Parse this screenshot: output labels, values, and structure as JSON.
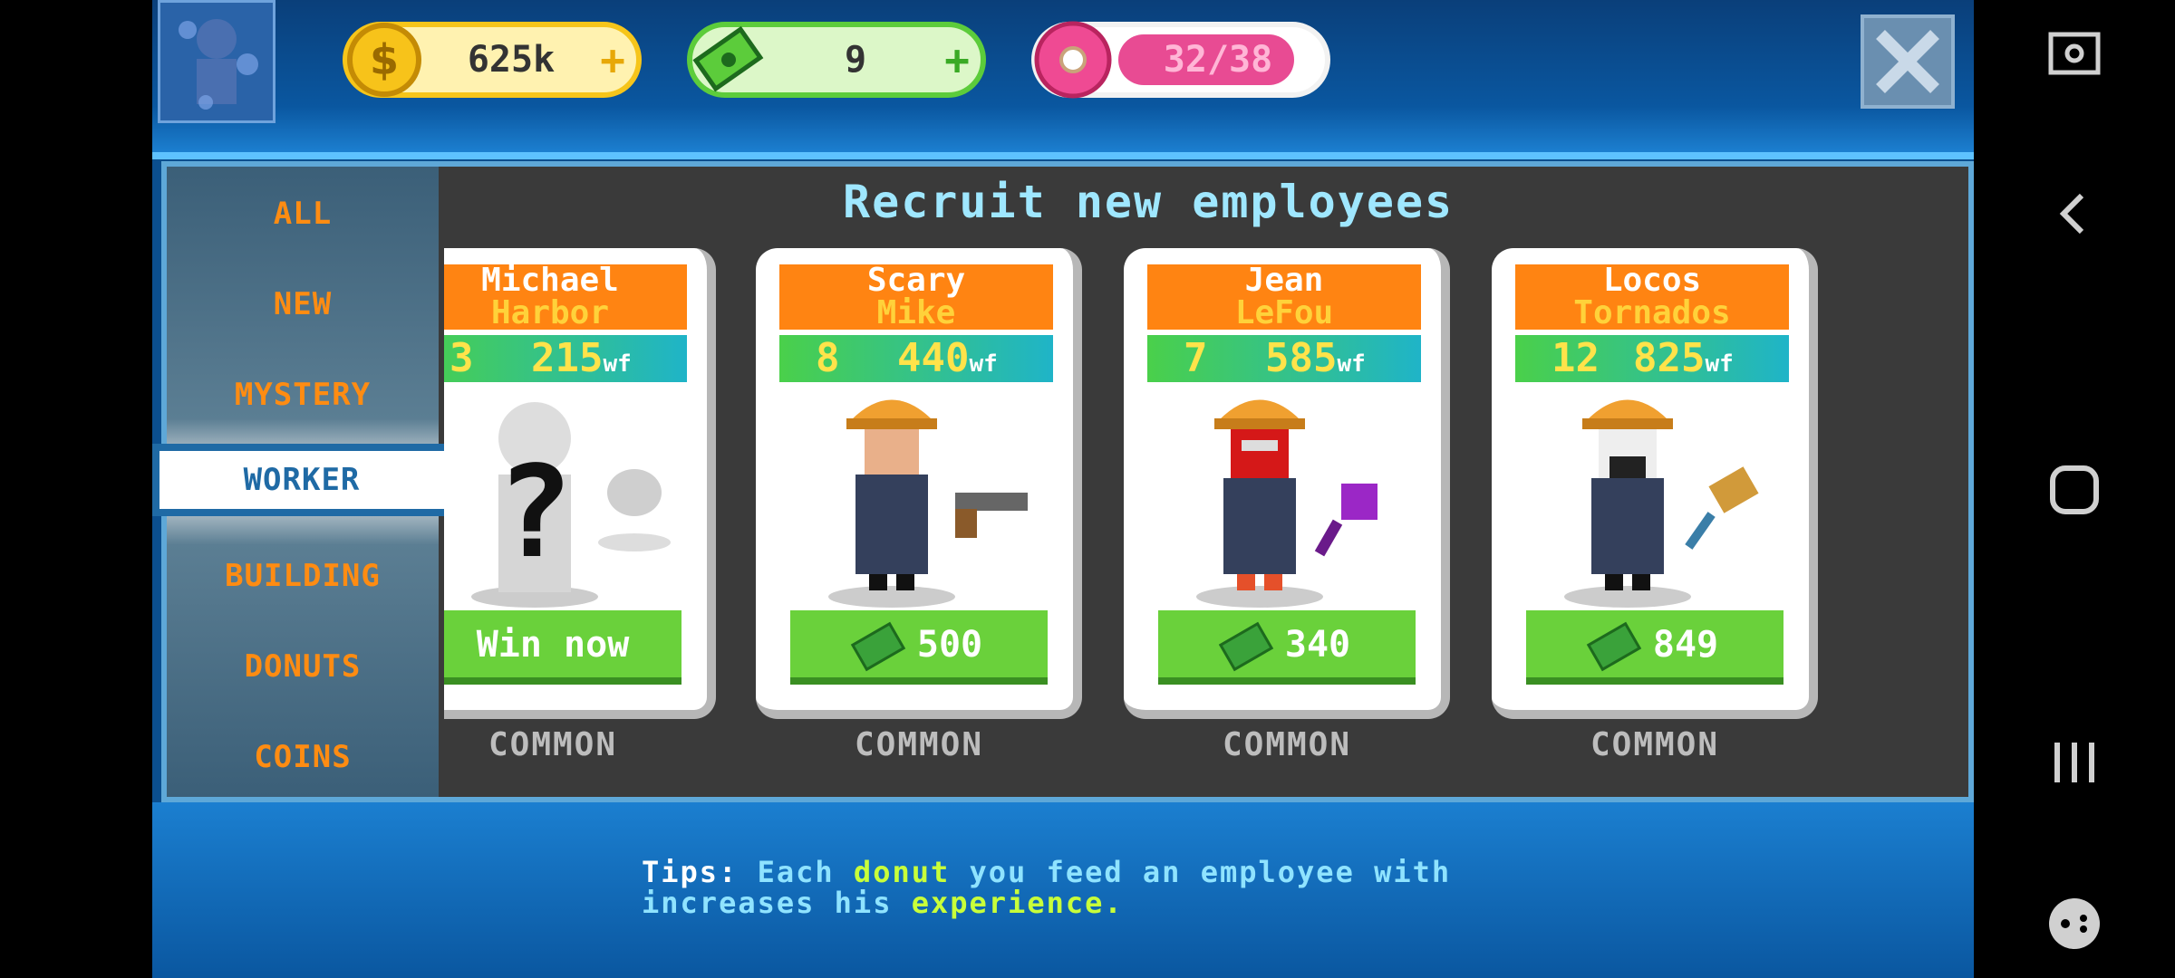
{
  "topbar": {
    "coins": "625k",
    "cash": "9",
    "donuts": "32/38",
    "donut_fill": 0.842,
    "plus": "+"
  },
  "panel": {
    "title": "Recruit new employees"
  },
  "tabs": [
    {
      "label": "ALL"
    },
    {
      "label": "NEW"
    },
    {
      "label": "MYSTERY"
    },
    {
      "label": "WORKER"
    },
    {
      "label": "BUILDING"
    },
    {
      "label": "DONUTS"
    },
    {
      "label": "COINS"
    }
  ],
  "cards": [
    {
      "first": "Michael",
      "last": "Harbor",
      "level": "3",
      "wf": "215",
      "unit": "wf",
      "cta": "Win now",
      "rarity": "COMMON"
    },
    {
      "first": "Scary",
      "last": "Mike",
      "level": "8",
      "wf": "440",
      "unit": "wf",
      "cta": "500",
      "rarity": "COMMON"
    },
    {
      "first": "Jean",
      "last": "LeFou",
      "level": "7",
      "wf": "585",
      "unit": "wf",
      "cta": "340",
      "rarity": "COMMON"
    },
    {
      "first": "Locos",
      "last": "Tornados",
      "level": "12",
      "wf": "825",
      "unit": "wf",
      "cta": "849",
      "rarity": "COMMON"
    }
  ],
  "tips": {
    "p1": "Tips:",
    "p2": "Each",
    "p3": "donut",
    "p4": "you feed an employee with",
    "p5": "increases his",
    "p6": "experience",
    "p7": "."
  },
  "colors": {
    "accent": "#ff8412",
    "panel": "#3a3a3a",
    "frame": "#5ea8d8"
  },
  "icons": [
    "coin-icon",
    "cash-icon",
    "donut-icon",
    "close-icon",
    "screenshot-icon",
    "back-icon",
    "home-icon",
    "recents-icon",
    "game-icon"
  ]
}
